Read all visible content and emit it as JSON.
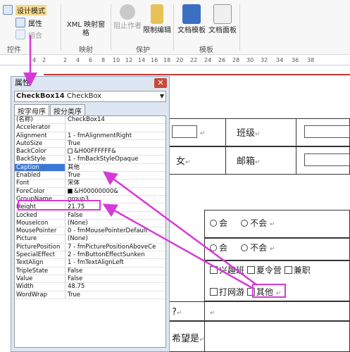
{
  "ribbon": {
    "design_mode": "设计模式",
    "properties": "属性",
    "combine": "组合",
    "xml_mapping_pane": "XML 映射窗格",
    "block_authors": "阻止作者",
    "restrict_editing": "限制编辑",
    "document_template": "文档模板",
    "document_panel": "文档面板",
    "group_controls": "控件",
    "group_mapping": "映射",
    "group_protect": "保护",
    "group_templates": "模板"
  },
  "ruler": [
    "4",
    "2",
    "2",
    "4",
    "6",
    "8",
    "10",
    "12",
    "14",
    "16",
    "18",
    "20",
    "22",
    "24",
    "26",
    "28",
    "30",
    "32",
    "34",
    "36",
    "38"
  ],
  "document": {
    "class_label": "班级",
    "gender_female": "女",
    "email_label": "邮箱",
    "yes1": "会",
    "no1": "不会",
    "yes2": "会",
    "no2": "不会",
    "opt_interest_class": "兴趣班",
    "opt_summer_camp": "夏令营",
    "opt_part_time": "兼职",
    "opt_online_games": "打网游",
    "opt_other": "其他",
    "q_mark": "?",
    "hope_text": "希望是",
    "para_mark": "↵"
  },
  "props": {
    "title": "属性",
    "object_name": "CheckBox14",
    "object_type": "CheckBox",
    "tab_alpha": "按字母序",
    "tab_category": "按分类序",
    "rows": [
      {
        "name": "(名称)",
        "value": "CheckBox14"
      },
      {
        "name": "Accelerator",
        "value": ""
      },
      {
        "name": "Alignment",
        "value": "1 - fmAlignmentRight"
      },
      {
        "name": "AutoSize",
        "value": "True"
      },
      {
        "name": "BackColor",
        "value": "&H00FFFFFF&"
      },
      {
        "name": "BackStyle",
        "value": "1 - fmBackStyleOpaque"
      },
      {
        "name": "Caption",
        "value": "其他"
      },
      {
        "name": "Enabled",
        "value": "True"
      },
      {
        "name": "Font",
        "value": "宋体"
      },
      {
        "name": "ForeColor",
        "value": "&H00000000&"
      },
      {
        "name": "GroupName",
        "value": "group3"
      },
      {
        "name": "Height",
        "value": "21.75"
      },
      {
        "name": "Locked",
        "value": "False"
      },
      {
        "name": "MouseIcon",
        "value": "(None)"
      },
      {
        "name": "MousePointer",
        "value": "0 - fmMousePointerDefault"
      },
      {
        "name": "Picture",
        "value": "(None)"
      },
      {
        "name": "PicturePosition",
        "value": "7 - fmPicturePositionAboveCe"
      },
      {
        "name": "SpecialEffect",
        "value": "2 - fmButtonEffectSunken"
      },
      {
        "name": "TextAlign",
        "value": "1 - fmTextAlignLeft"
      },
      {
        "name": "TripleState",
        "value": "False"
      },
      {
        "name": "Value",
        "value": "False"
      },
      {
        "name": "Width",
        "value": "48.75"
      },
      {
        "name": "WordWrap",
        "value": "True"
      }
    ],
    "swatch_white": "#FFFFFF",
    "swatch_black": "#000000"
  },
  "colors": {
    "highlight": "#d63ad6",
    "selected_row": "#3a78d6",
    "header_red": "#c7372f"
  }
}
